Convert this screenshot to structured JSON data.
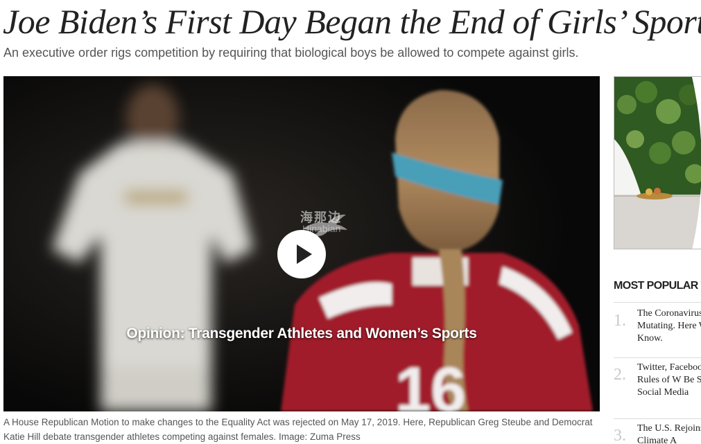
{
  "article": {
    "headline": "Joe Biden’s First Day Began the End of Girls’ Sports",
    "dek": "An executive order rigs competition by requiring that biological boys be allowed to compete against girls."
  },
  "video": {
    "title": "Opinion: Transgender Athletes and Women’s Sports",
    "jersey_number": "16",
    "watermark_cn": "海那边",
    "watermark_en": "Hinabian",
    "caption": "A House Republican Motion to make changes to the Equality Act was rejected on May 17, 2019. Here, Republican Greg Steube and Democrat Katie Hill debate transgender athletes competing against females. Image: Zuma Press"
  },
  "sidebar": {
    "most_popular_title": "MOST POPULAR V",
    "items": [
      {
        "num": "1.",
        "text": "The Coronavirus Mutating. Here We Know."
      },
      {
        "num": "2.",
        "text": "Twitter, Facebook the Rules of W Be Said on Social Media"
      },
      {
        "num": "3.",
        "text": "The U.S. Rejoins Paris Climate A"
      }
    ]
  }
}
